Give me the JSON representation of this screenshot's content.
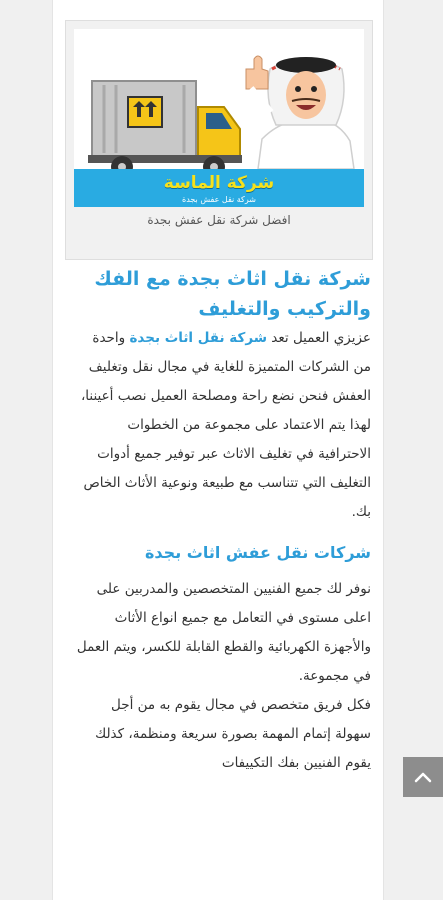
{
  "figure": {
    "brand_name": "شركة الماسة",
    "brand_tagline": "شركة نقل عفش بجدة",
    "caption": "افضل شركة نقل عفش بجدة"
  },
  "article": {
    "title": "شركة نقل اثاث بجدة مع الفك والتركيب والتغليف",
    "p1_before": "عزيزي العميل تعد ",
    "p1_link": "شركة نقل اثاث بجدة",
    "p1_after": " واحدة من الشركات المتميزة للغاية في مجال نقل وتغليف العفش فنحن نضع راحة ومصلحة العميل نصب أعيننا، لهذا يتم الاعتماد على مجموعة من الخطوات الاحترافية في تغليف الاثاث عبر توفير جميع أدوات التغليف التي تتناسب مع طبيعة ونوعية الأثاث الخاص بك.",
    "subheading": "شركات نقل عفش اثاث بجدة",
    "p2": "نوفر لك جميع الفنيين المتخصصين والمدربين على اعلى مستوى في التعامل مع جميع انواع الأثاث والأجهزة الكهربائية والقطع القابلة للكسر، ويتم العمل في مجموعة.",
    "p3": "فكل فريق متخصص في مجال يقوم به من أجل سهولة إتمام المهمة بصورة سريعة ومنظمة، كذلك يقوم الفنيين بفك التكييفات"
  },
  "colors": {
    "accent": "#2e9dd8",
    "brand_band": "#29abe2",
    "brand_text": "#f7e11b",
    "scroll_button": "#8d8d8d"
  },
  "icons": {
    "scroll_top": "chevron-up-icon"
  }
}
